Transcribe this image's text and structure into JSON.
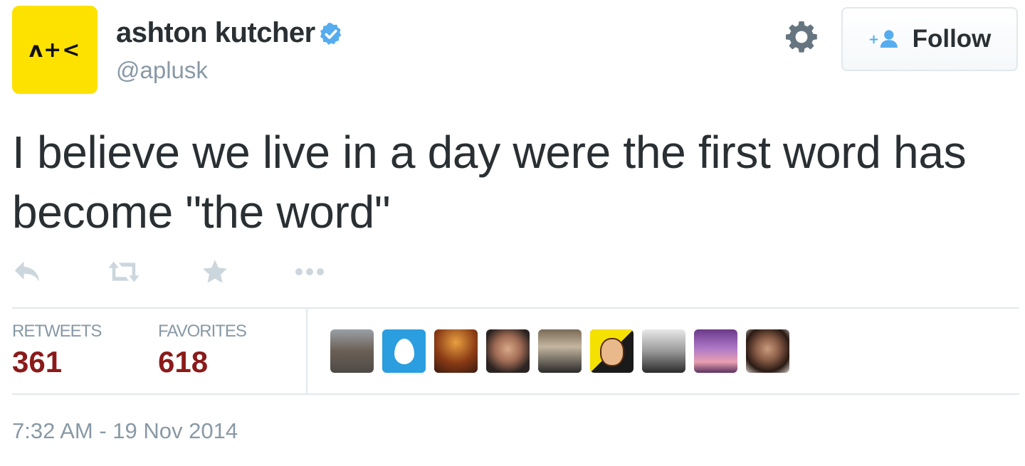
{
  "user": {
    "avatar_text": "ʌ+<",
    "display_name": "ashton kutcher",
    "handle": "@aplusk",
    "verified": true
  },
  "actions_header": {
    "follow_label": "Follow"
  },
  "tweet": {
    "text": "I believe we live in a day were the first word has become \"the word\""
  },
  "stats": {
    "retweets_label": "RETWEETS",
    "retweets_count": "361",
    "favorites_label": "FAVORITES",
    "favorites_count": "618"
  },
  "timestamp": "7:32 AM - 19 Nov 2014",
  "colors": {
    "avatar_bg": "#fde200",
    "verified": "#55acee",
    "count": "#8b1a1a",
    "muted": "#8899a6",
    "follow_icon": "#55acee"
  }
}
